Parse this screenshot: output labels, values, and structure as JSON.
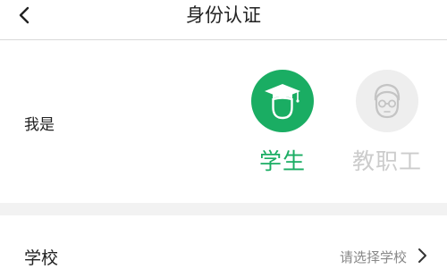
{
  "header": {
    "title": "身份认证"
  },
  "role": {
    "label": "我是",
    "selected": "student",
    "options": [
      {
        "id": "student",
        "label": "学生",
        "color": "#1aad63",
        "icon": "graduation-cap-icon"
      },
      {
        "id": "staff",
        "label": "教职工",
        "color": "#cccccc",
        "icon": "faculty-person-icon"
      }
    ]
  },
  "school": {
    "label": "学校",
    "placeholder": "请选择学校"
  },
  "colors": {
    "accent": "#1aad63",
    "inactive": "#cccccc",
    "inactive_circle": "#eeeeee",
    "divider": "#f2f2f2"
  }
}
